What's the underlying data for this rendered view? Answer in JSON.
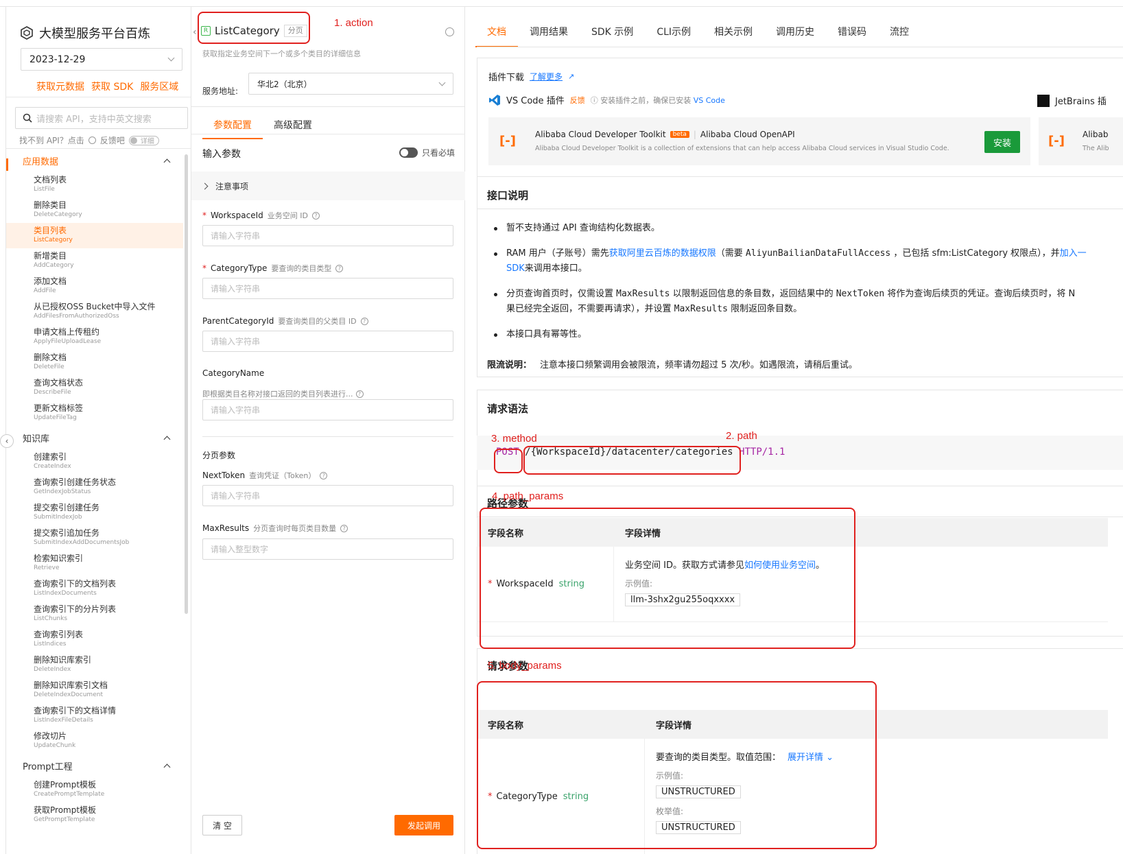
{
  "sidebar": {
    "title": "大模型服务平台百炼",
    "date_value": "2023-12-29",
    "quick_links": [
      "获取元数据",
      "获取 SDK",
      "服务区域"
    ],
    "search_placeholder": "请搜索 API，支持中英文搜索",
    "help_text": "找不到 API？点击",
    "feedback_text": "反馈吧",
    "detail_toggle": "详细",
    "groups": [
      {
        "label": "应用数据",
        "items": [
          {
            "cn": "文档列表",
            "en": "ListFile"
          },
          {
            "cn": "删除类目",
            "en": "DeleteCategory"
          },
          {
            "cn": "类目列表",
            "en": "ListCategory"
          },
          {
            "cn": "新增类目",
            "en": "AddCategory"
          },
          {
            "cn": "添加文档",
            "en": "AddFile"
          },
          {
            "cn": "从已授权OSS Bucket中导入文件",
            "en": "AddFilesFromAuthorizedOss"
          },
          {
            "cn": "申请文档上传租约",
            "en": "ApplyFileUploadLease"
          },
          {
            "cn": "删除文档",
            "en": "DeleteFile"
          },
          {
            "cn": "查询文档状态",
            "en": "DescribeFile"
          },
          {
            "cn": "更新文档标签",
            "en": "UpdateFileTag"
          }
        ]
      },
      {
        "label": "知识库",
        "items": [
          {
            "cn": "创建索引",
            "en": "CreateIndex"
          },
          {
            "cn": "查询索引创建任务状态",
            "en": "GetIndexJobStatus"
          },
          {
            "cn": "提交索引创建任务",
            "en": "SubmitIndexJob"
          },
          {
            "cn": "提交索引追加任务",
            "en": "SubmitIndexAddDocumentsJob"
          },
          {
            "cn": "检索知识索引",
            "en": "Retrieve"
          },
          {
            "cn": "查询索引下的文档列表",
            "en": "ListIndexDocuments"
          },
          {
            "cn": "查询索引下的分片列表",
            "en": "ListChunks"
          },
          {
            "cn": "查询索引列表",
            "en": "ListIndices"
          },
          {
            "cn": "删除知识库索引",
            "en": "DeleteIndex"
          },
          {
            "cn": "删除知识库索引文档",
            "en": "DeleteIndexDocument"
          },
          {
            "cn": "查询索引下的文档详情",
            "en": "ListIndexFileDetails"
          },
          {
            "cn": "修改切片",
            "en": "UpdateChunk"
          }
        ]
      },
      {
        "label": "Prompt工程",
        "items": [
          {
            "cn": "创建Prompt模板",
            "en": "CreatePromptTemplate"
          },
          {
            "cn": "获取Prompt模板",
            "en": "GetPromptTemplate"
          }
        ]
      }
    ]
  },
  "middle": {
    "api_name": "ListCategory",
    "api_tag": "分页",
    "api_desc": "获取指定业务空间下一个或多个类目的详细信息",
    "service_label": "服务地址:",
    "service_value": "华北2（北京）",
    "tabs": [
      "参数配置",
      "高级配置"
    ],
    "input_params_title": "输入参数",
    "required_only_label": "只看必填",
    "notice_label": "注意事项",
    "fields": {
      "workspace": {
        "name": "WorkspaceId",
        "hint": "业务空间 ID",
        "placeholder": "请输入字符串"
      },
      "category_type": {
        "name": "CategoryType",
        "hint": "要查询的类目类型",
        "placeholder": "请输入字符串"
      },
      "parent_category": {
        "name": "ParentCategoryId",
        "hint": "要查询类目的父类目 ID",
        "placeholder": "请输入字符串"
      },
      "category_name": {
        "name": "CategoryName",
        "hint": "即根据类目名称对接口返回的类目列表进行...",
        "placeholder": "请输入字符串"
      },
      "next_token": {
        "name": "NextToken",
        "hint": "查询凭证（Token）",
        "placeholder": "请输入字符串"
      },
      "max_results": {
        "name": "MaxResults",
        "hint": "分页查询时每页类目数量",
        "placeholder": "请输入整型数字"
      }
    },
    "page_params_title": "分页参数",
    "clear_button": "清 空",
    "call_button": "发起调用"
  },
  "right": {
    "tabs": [
      "文档",
      "调用结果",
      "SDK 示例",
      "CLI示例",
      "相关示例",
      "调用历史",
      "错误码",
      "流控"
    ],
    "plugin": {
      "title": "插件下载",
      "learn_more": "了解更多",
      "vscode_label": "VS Code 插件",
      "feedback": "反馈",
      "install_note": "安装插件之前，确保已安装",
      "install_note_link": "VS Code",
      "jetbrains_label": "JetBrains 插",
      "toolkit_name": "Alibaba Cloud Developer Toolkit",
      "beta": "beta",
      "openapi_label": "Alibaba Cloud OpenAPI",
      "toolkit_desc": "Alibaba Cloud Developer Toolkit is a collection of extensions that can help access Alibaba Cloud services in Visual Studio Code.",
      "install_button": "安装",
      "card2_title": "Alibab",
      "card2_desc": "The Alib"
    },
    "api_desc_title": "接口说明",
    "bullets": [
      "暂不支持通过 API 查询结构化数据表。",
      "RAM 用户（子账号）需先",
      "获取阿里云百炼的数据权限",
      "（需要",
      "AliyunBailianDataFullAccess",
      "，已包括 sfm:ListCategory 权限点），并",
      "加入一",
      "SDK",
      "来调用本接口。",
      "分页查询首页时，仅需设置",
      "MaxResults",
      "以限制返回信息的条目数，返回结果中的",
      "NextToken",
      "将作为查询后续页的凭证。查询后续页时，将 N",
      "果已经完全返回，不需要再请求），并设置",
      "MaxResults",
      "限制返回条目数。",
      "本接口具有幂等性。"
    ],
    "limit_label": "限流说明：",
    "limit_text": "注意本接口频繁调用会被限流，频率请勿超过 5 次/秒。如遇限流，请稍后重试。",
    "request_syntax_title": "请求语法",
    "method": "POST",
    "path": "/{WorkspaceId}/datacenter/categories",
    "http": "HTTP/1.1",
    "path_params_title": "路径参数",
    "table_headers": [
      "字段名称",
      "字段详情"
    ],
    "path_param": {
      "name": "WorkspaceId",
      "type": "string",
      "desc": "业务空间 ID。获取方式请参见",
      "desc_link": "如何使用业务空间",
      "desc_end": "。",
      "example_label": "示例值:",
      "example": "llm-3shx2gu255oqxxxx"
    },
    "body_params_title": "请求参数",
    "body_param": {
      "name": "CategoryType",
      "type": "string",
      "desc": "要查询的类目类型。取值范围：",
      "expand": "展开详情",
      "example_label": "示例值:",
      "example": "UNSTRUCTURED",
      "enum_label": "枚举值:",
      "enum": "UNSTRUCTURED"
    }
  },
  "annotations": {
    "action": "1. action",
    "path": "2. path",
    "method": "3. method",
    "path_params": "4. path_params",
    "body_params": "5. body_params"
  }
}
